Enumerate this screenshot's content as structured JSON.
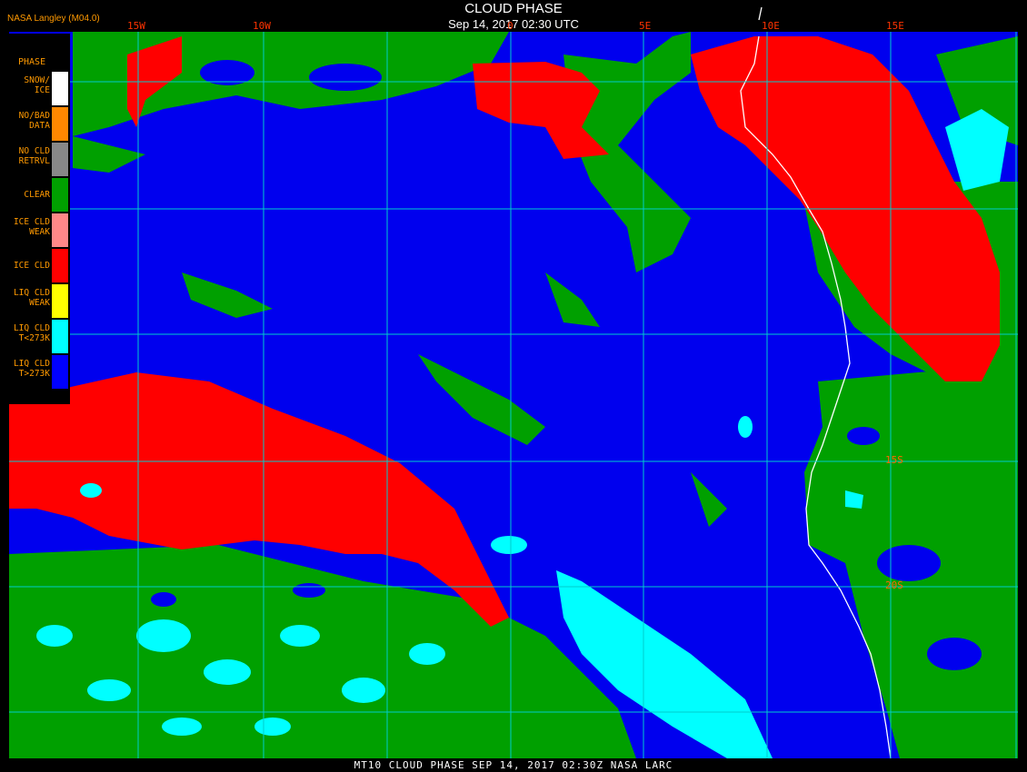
{
  "header": {
    "title": "CLOUD PHASE",
    "subtitle": "Sep 14, 2017 02:30 UTC",
    "agency": "NASA Langley (M04.0)"
  },
  "footer": {
    "text": "MT10  CLOUD PHASE   SEP 14, 2017 02:30Z   NASA LARC"
  },
  "longitude_labels": [
    "15W",
    "10W",
    "0",
    "5E",
    "10E",
    "15E"
  ],
  "latitude_labels": [
    "15S",
    "20S"
  ],
  "legend": {
    "title": "PHASE",
    "items": [
      {
        "label": "SNOW/\nICE",
        "color": "#ffffff"
      },
      {
        "label": "NO/BAD\nDATA",
        "color": "#ff8800"
      },
      {
        "label": "NO CLD\nRETRVL",
        "color": "#888888"
      },
      {
        "label": "CLEAR",
        "color": "#00a000"
      },
      {
        "label": "ICE CLD\nWEAK",
        "color": "#ff8888"
      },
      {
        "label": "ICE CLD",
        "color": "#ff0000"
      },
      {
        "label": "LIQ CLD\nWEAK",
        "color": "#ffff00"
      },
      {
        "label": "LIQ CLD\nT<273K",
        "color": "#00ffff"
      },
      {
        "label": "LIQ CLD\nT>273K",
        "color": "#0000ff"
      }
    ]
  },
  "colors": {
    "liquid_warm": "#0000ee",
    "liquid_cold": "#00ffff",
    "clear": "#00a000",
    "ice": "#ff0000",
    "grid": "#00cccc",
    "coast": "#ffffff"
  }
}
